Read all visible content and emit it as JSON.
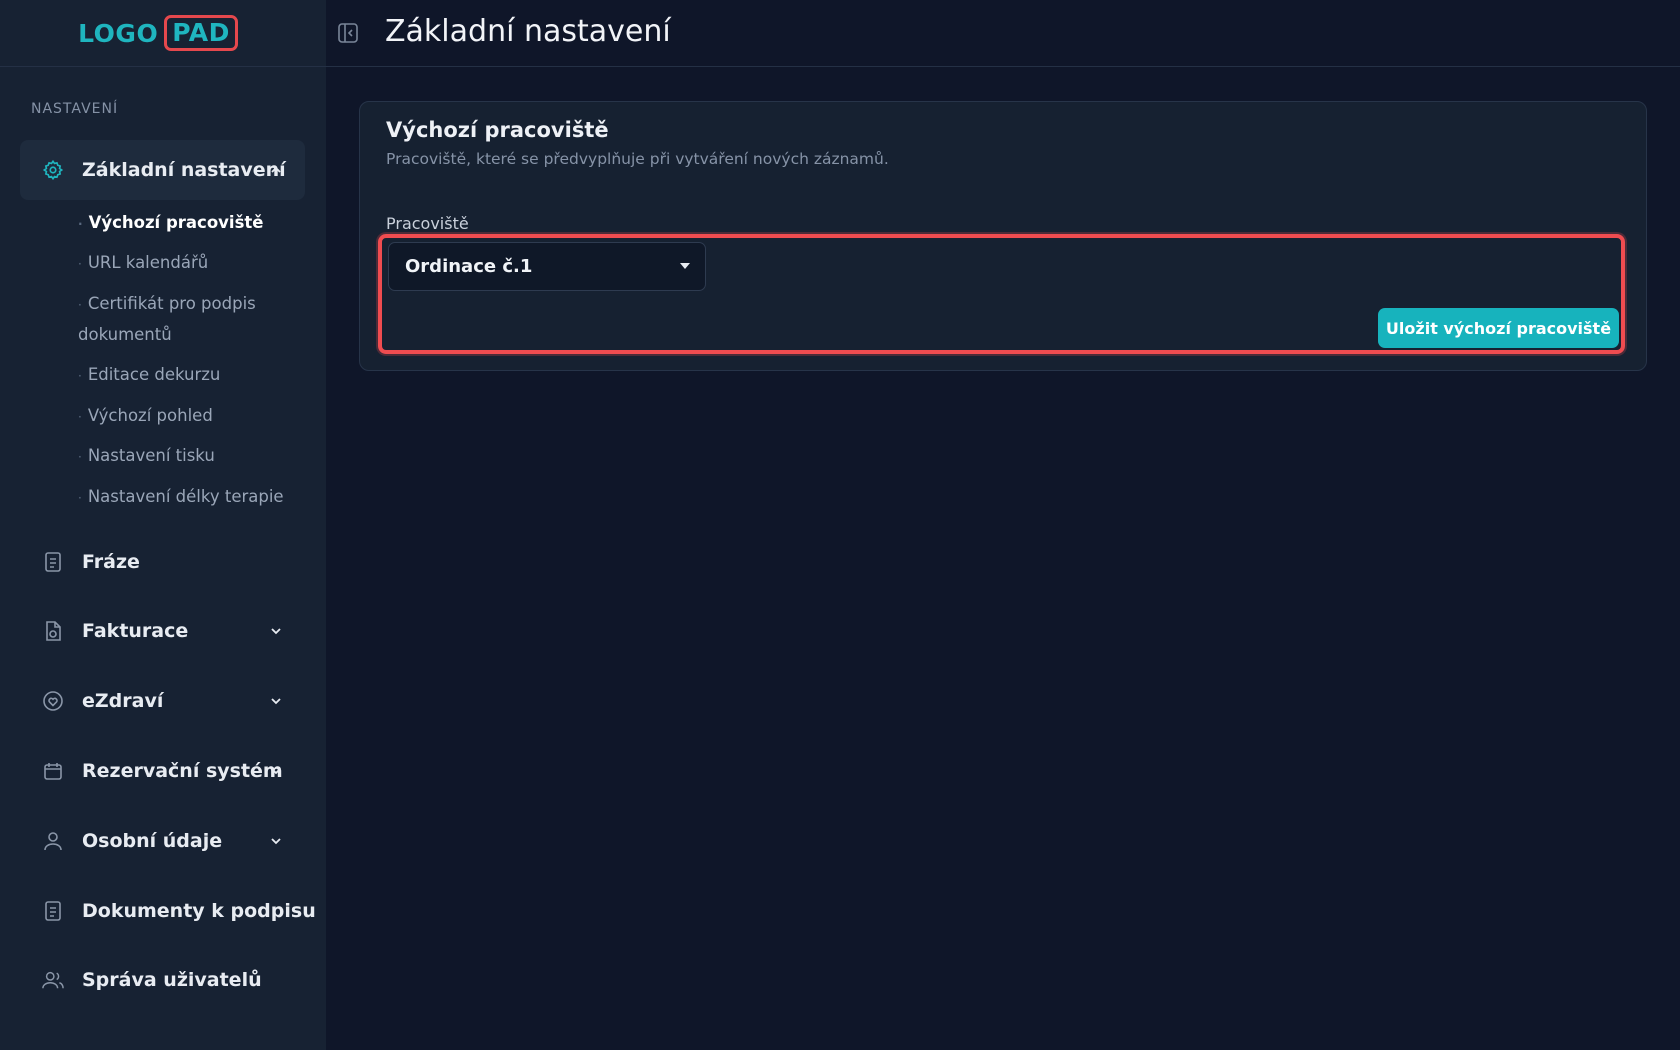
{
  "logo": {
    "part1": "LOGO",
    "part2": "PAD"
  },
  "sidebar": {
    "section_label": "NASTAVENÍ",
    "active_item": {
      "label": "Základní nastavení",
      "icon": "gear-icon"
    },
    "sub_items": [
      {
        "label": "Výchozí pracoviště",
        "active": true
      },
      {
        "label": "URL kalendářů"
      },
      {
        "label": "Certifikát pro podpis dokumentů"
      },
      {
        "label": "Editace dekurzu"
      },
      {
        "label": "Výchozí pohled"
      },
      {
        "label": "Nastavení tisku"
      },
      {
        "label": "Nastavení délky terapie"
      }
    ],
    "items": [
      {
        "label": "Fráze",
        "icon": "document-icon"
      },
      {
        "label": "Fakturace",
        "icon": "invoice-icon"
      },
      {
        "label": "eZdraví",
        "icon": "heart-icon"
      },
      {
        "label": "Rezervační systém",
        "icon": "calendar-icon"
      },
      {
        "label": "Osobní údaje",
        "icon": "user-icon"
      },
      {
        "label": "Dokumenty k podpisu",
        "icon": "document-icon"
      },
      {
        "label": "Správa uživatelů",
        "icon": "users-icon"
      }
    ]
  },
  "header": {
    "title": "Základní nastavení"
  },
  "card": {
    "title": "Výchozí pracoviště",
    "subtitle": "Pracoviště, které se předvyplňuje při vytváření nových záznamů.",
    "field_label": "Pracoviště",
    "select_value": "Ordinace č.1",
    "save_label": "Uložit výchozí pracoviště"
  },
  "colors": {
    "accent": "#17b3bd",
    "highlight": "#ef4c50",
    "sidebar_bg": "#172233",
    "page_bg": "#0f1629"
  }
}
